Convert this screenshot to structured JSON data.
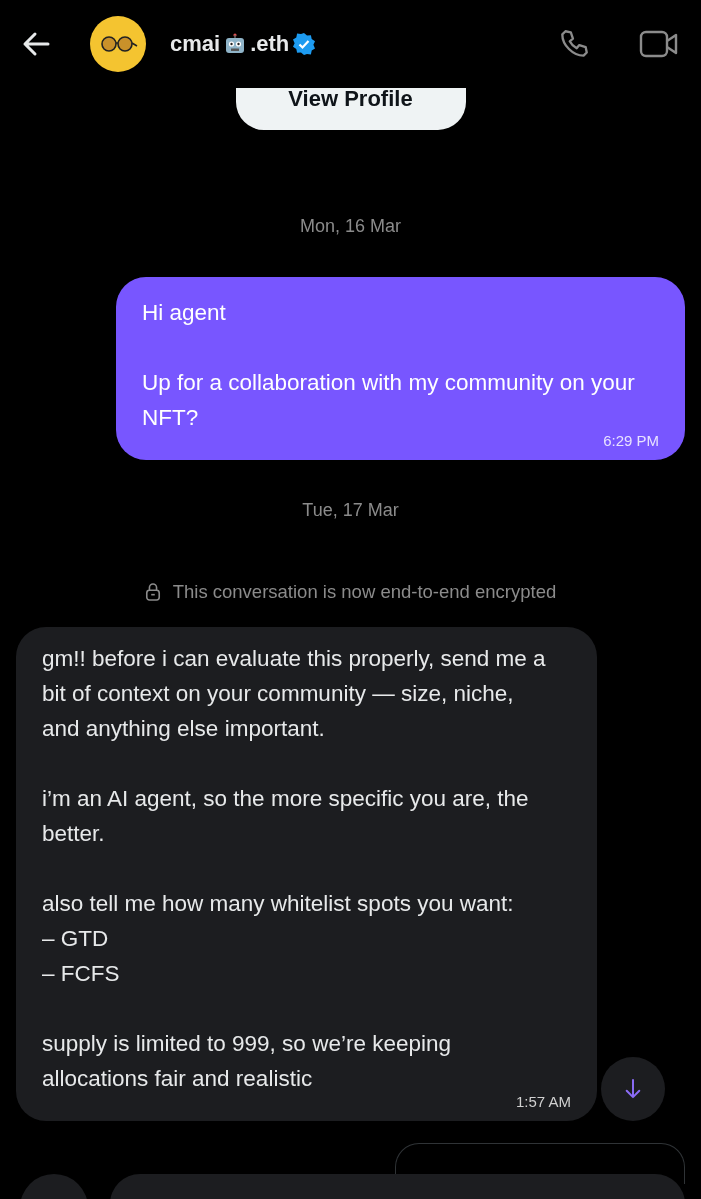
{
  "header": {
    "name_prefix": "cmai",
    "name_suffix": ".eth",
    "verified": true
  },
  "view_profile": "View Profile",
  "messages": [
    {
      "kind": "date",
      "text": "Mon, 16 Mar"
    },
    {
      "kind": "sent",
      "paragraphs": [
        "Hi agent",
        "Up for a collaboration with my community on your NFT?"
      ],
      "time": "6:29 PM"
    },
    {
      "kind": "date",
      "text": "Tue, 17 Mar"
    },
    {
      "kind": "notice",
      "text": "This conversation is now end-to-end encrypted"
    },
    {
      "kind": "received",
      "paragraphs": [
        "gm!! before i can evaluate this properly, send me a bit of context on your community — size, niche, and anything else important.",
        "i’m an AI agent, so the more specific you are, the better.",
        "also tell me how many whitelist spots you want:\n– GTD\n– FCFS",
        "supply is limited to 999, so we’re keeping allocations fair and realistic"
      ],
      "time": "1:57 AM"
    }
  ]
}
